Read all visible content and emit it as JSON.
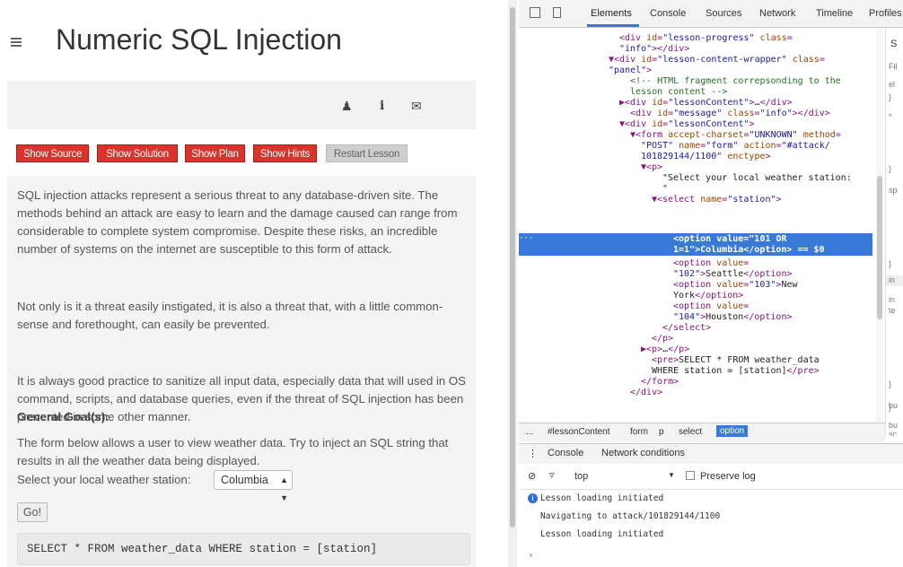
{
  "lesson": {
    "title": "Numeric SQL Injection",
    "header_icons": [
      "user-icon",
      "info-icon",
      "envelope-icon"
    ],
    "buttons": [
      "Show Source",
      "Show Solution",
      "Show Plan",
      "Show Hints",
      "Restart Lesson"
    ],
    "paragraphs": [
      "SQL injection attacks represent a serious threat to any database-driven site. The methods behind an attack are easy to learn and the damage caused can range from considerable to complete system compromise. Despite these risks, an incredible number of systems on the internet are susceptible to this form of attack.",
      "Not only is it a threat easily instigated, it is also a threat that, with a little common-sense and forethought, can easily be prevented.",
      "It is always good practice to sanitize all input data, especially data that will used in OS command, scripts, and database queries, even if the threat of SQL injection has been prevented in some other manner.",
      "The form below allows a user to view weather data. Try to inject an SQL string that results in all the weather data being displayed."
    ],
    "goal_heading": "General Goal(s):",
    "station_label": "Select your local weather station:",
    "station_selected": "Columbia",
    "go_label": "Go!",
    "sql": "SELECT * FROM weather_data WHERE station = [station]"
  },
  "devtools": {
    "tabs": [
      "Elements",
      "Console",
      "Sources",
      "Network",
      "Timeline",
      "Profiles"
    ],
    "active_tab": "Elements",
    "dom_lines": [
      "<div id=\"lesson-progress\" class=\"info\"></div>",
      "<div id=\"lesson-content-wrapper\" class=\"panel\">",
      "<!-- HTML fragment correpsonding to the lesson content -->",
      "<div id=\"lessonContent\">…</div>",
      "<div id=\"message\" class=\"info\"></div>",
      "<div id=\"lessonContent\">",
      "<form accept-charset=\"UNKNOWN\" method=\"POST\" name=\"form\" action=\"#attack/101829144/1100\" enctype>",
      "<p>",
      "\"Select your local weather station: \"",
      "<select name=\"station\">",
      "<option value=\"101 OR 1=1\">Columbia</option> == $0",
      "<option value=\"102\">Seattle</option>",
      "<option value=\"103\">New York</option>",
      "<option value=\"104\">Houston</option>",
      "</select>",
      "</p>",
      "<p>…</p>",
      "<pre>SELECT * FROM weather_data WHERE station = [station]</pre>",
      "</form>",
      "</div>"
    ],
    "breadcrumbs": [
      "...",
      "#lessonContent",
      "form",
      "p",
      "select",
      "option"
    ],
    "drawer_tabs": [
      "Console",
      "Network conditions"
    ],
    "console_filter": "top",
    "preserve_log_label": "Preserve log",
    "console_lines": [
      "Lesson loading initiated",
      "Navigating to attack/101829144/1100",
      "Lesson loading initiated"
    ],
    "styles_fragments": [
      "S",
      "Fil",
      "el",
      "}",
      "*",
      "}",
      "sp",
      "}",
      "in",
      "in",
      "te",
      "}",
      "bu",
      "}",
      "bu",
      "sc"
    ]
  }
}
